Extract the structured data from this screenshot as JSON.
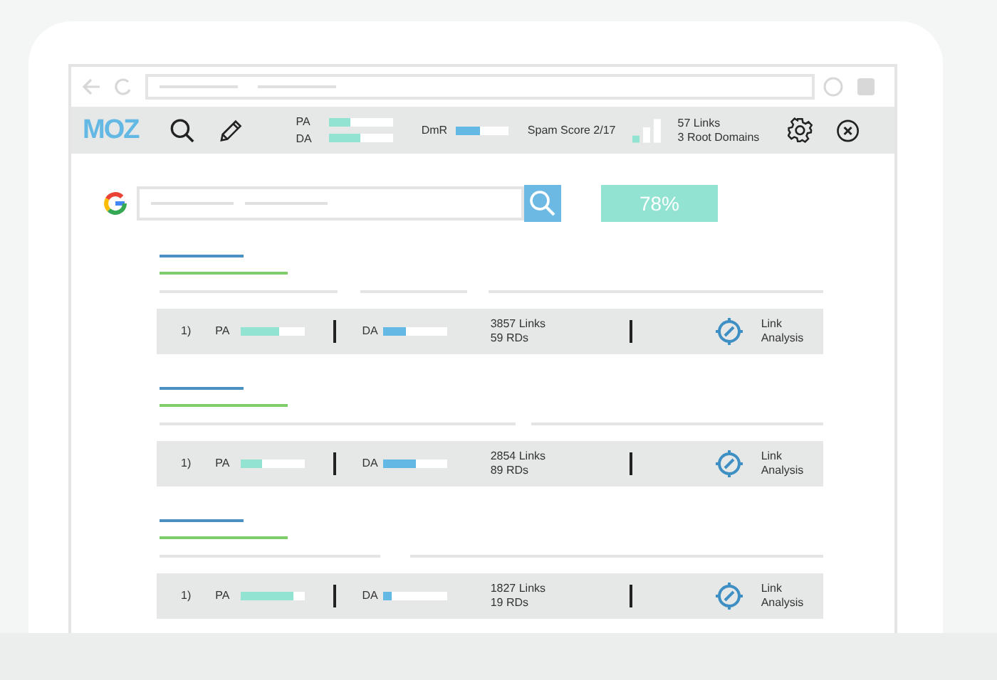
{
  "toolbar": {
    "logo": "MOZ",
    "pa": {
      "label": "PA",
      "level": 0.33
    },
    "da": {
      "label": "DA",
      "level": 0.5
    },
    "dmr": {
      "label": "DmR",
      "level": 0.45
    },
    "spam_score": "Spam Score 2/17",
    "links": "57 Links",
    "root_domains": "3 Root Domains"
  },
  "search": {
    "score": "78%"
  },
  "results": [
    {
      "rank": "1)",
      "pa": {
        "label": "PA",
        "level": 0.6
      },
      "da": {
        "label": "DA",
        "level": 0.35
      },
      "links": "3857 Links",
      "rds": "59 RDs",
      "action": "Link Analysis"
    },
    {
      "rank": "1)",
      "pa": {
        "label": "PA",
        "level": 0.33
      },
      "da": {
        "label": "DA",
        "level": 0.5
      },
      "links": "2854 Links",
      "rds": "89 RDs",
      "action": "Link Analysis"
    },
    {
      "rank": "1)",
      "pa": {
        "label": "PA",
        "level": 0.82
      },
      "da": {
        "label": "DA",
        "level": 0.13
      },
      "links": "1827 Links",
      "rds": "19 RDs",
      "action": "Link Analysis"
    }
  ]
}
